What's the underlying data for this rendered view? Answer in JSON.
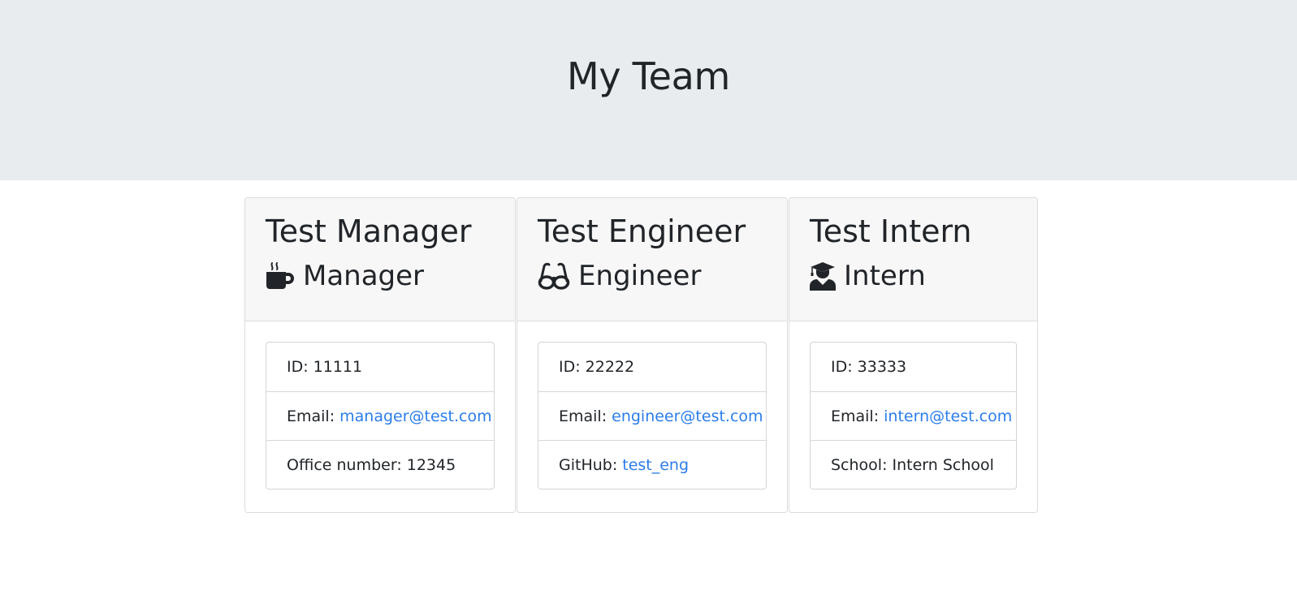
{
  "header": {
    "title": "My Team"
  },
  "colors": {
    "link": "#2b7de9",
    "jumbotron_bg": "#e9ecef"
  },
  "team": [
    {
      "name": "Test Manager",
      "role": "Manager",
      "icon": "mug-hot-icon",
      "id_label": "ID:",
      "id": "11111",
      "email_label": "Email:",
      "email": "manager@test.com",
      "extra_label": "Office number:",
      "extra": "12345"
    },
    {
      "name": "Test Engineer",
      "role": "Engineer",
      "icon": "glasses-icon",
      "id_label": "ID:",
      "id": "22222",
      "email_label": "Email:",
      "email": "engineer@test.com",
      "extra_label": "GitHub:",
      "extra": "test_eng"
    },
    {
      "name": "Test Intern",
      "role": "Intern",
      "icon": "user-graduate-icon",
      "id_label": "ID:",
      "id": "33333",
      "email_label": "Email:",
      "email": "intern@test.com",
      "extra_label": "School:",
      "extra": "Intern School"
    }
  ]
}
